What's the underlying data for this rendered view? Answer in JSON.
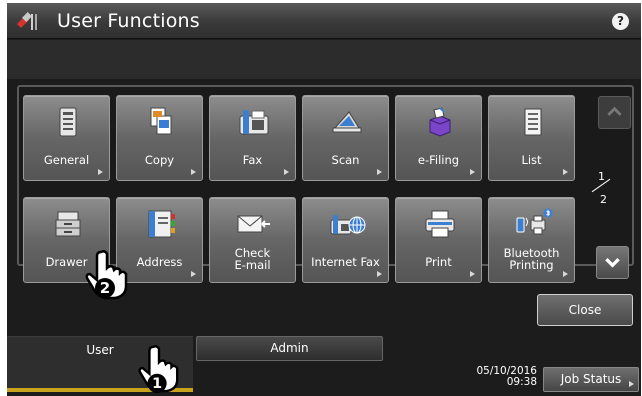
{
  "title_bar": {
    "title": "User Functions",
    "help_label": "?"
  },
  "function_buttons": [
    {
      "label": "General",
      "icon": "general-settings-icon"
    },
    {
      "label": "Copy",
      "icon": "copy-icon"
    },
    {
      "label": "Fax",
      "icon": "fax-icon"
    },
    {
      "label": "Scan",
      "icon": "scan-icon"
    },
    {
      "label": "e-Filing",
      "icon": "e-filing-icon"
    },
    {
      "label": "List",
      "icon": "list-icon"
    },
    {
      "label": "Drawer",
      "icon": "drawer-icon"
    },
    {
      "label": "Address",
      "icon": "address-book-icon"
    },
    {
      "label": "Check\nE-mail",
      "icon": "check-email-icon"
    },
    {
      "label": "Internet Fax",
      "icon": "internet-fax-icon"
    },
    {
      "label": "Print",
      "icon": "print-icon"
    },
    {
      "label": "Bluetooth\nPrinting",
      "icon": "bluetooth-printing-icon"
    }
  ],
  "pagination": {
    "current": "1",
    "total": "2"
  },
  "close_label": "Close",
  "tabs": {
    "user": "User",
    "admin": "Admin",
    "active": "User"
  },
  "datetime": {
    "date": "05/10/2016",
    "time": "09:38"
  },
  "job_status_label": "Job Status",
  "callouts": {
    "step1": "1",
    "step2": "2"
  },
  "colors": {
    "active_tab_accent": "#c9a31e",
    "screen_bg": "#1c1c1c",
    "button_face": "#6a6a6a"
  }
}
